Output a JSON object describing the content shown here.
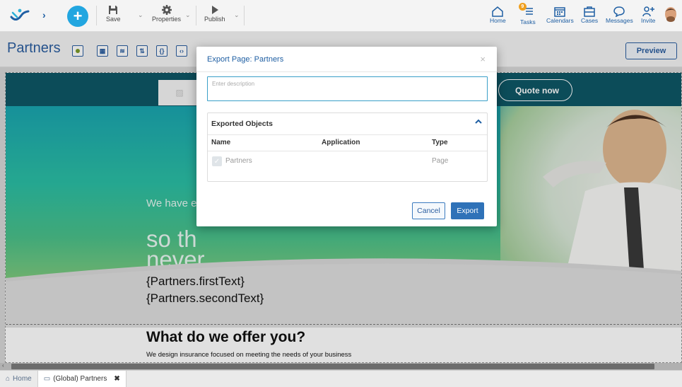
{
  "toolbar": {
    "save_label": "Save",
    "properties_label": "Properties",
    "publish_label": "Publish"
  },
  "nav": {
    "home": "Home",
    "tasks": "Tasks",
    "tasks_badge": "9",
    "calendars": "Calendars",
    "cases": "Cases",
    "messages": "Messages",
    "invite": "Invite"
  },
  "page": {
    "title": "Partners",
    "preview_label": "Preview"
  },
  "canvas": {
    "quote_button": "Quote now",
    "hero_small": "We have e",
    "hero_big": "so th never stop",
    "first_text": "{Partners.firstText}",
    "second_text": "{Partners.secondText}",
    "offer_title": "What do we offer you?",
    "offer_subtitle": "We design insurance focused on meeting the needs of your business"
  },
  "tabs": {
    "home": "Home",
    "active": "(Global) Partners"
  },
  "modal": {
    "title": "Export Page: Partners",
    "close_symbol": "×",
    "description_placeholder": "Enter description",
    "panel_title": "Exported Objects",
    "columns": [
      "Name",
      "Application",
      "Type"
    ],
    "rows": [
      {
        "name": "Partners",
        "application": "",
        "type": "Page"
      }
    ],
    "cancel_label": "Cancel",
    "export_label": "Export"
  },
  "colors": {
    "accent": "#2b5ea0",
    "primary_button": "#2f72b8",
    "hero_dark": "#0e5766"
  }
}
